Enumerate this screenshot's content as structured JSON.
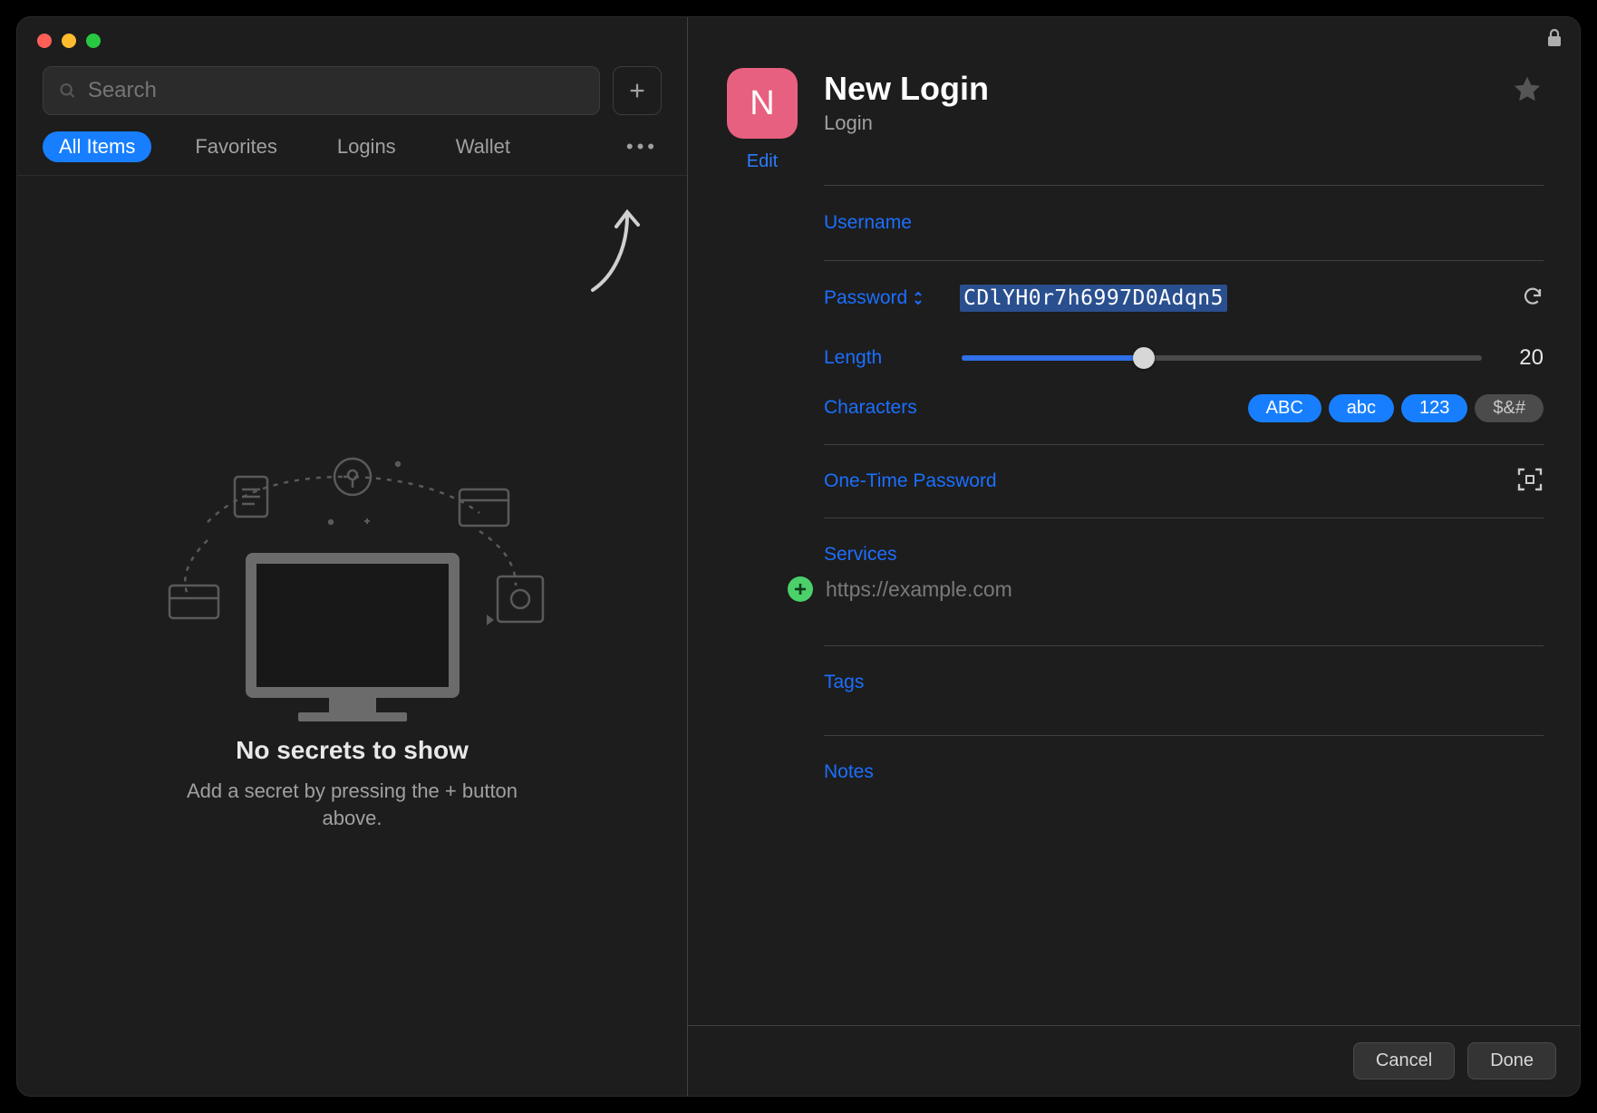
{
  "sidebar": {
    "search_placeholder": "Search",
    "tabs": [
      "All Items",
      "Favorites",
      "Logins",
      "Wallet"
    ],
    "active_tab_index": 0
  },
  "empty_state": {
    "title": "No secrets to show",
    "subtitle": "Add a secret by pressing the + button above."
  },
  "item": {
    "avatar_letter": "N",
    "title": "New Login",
    "type_label": "Login",
    "edit_label": "Edit",
    "username_label": "Username",
    "password_label": "Password",
    "password_value": "CDlYH0r7h6997D0Adqn5",
    "length_label": "Length",
    "length_value": "20",
    "length_min": 8,
    "length_max": 64,
    "length_fill_pct": 35,
    "characters_label": "Characters",
    "char_toggles": [
      {
        "label": "ABC",
        "on": true
      },
      {
        "label": "abc",
        "on": true
      },
      {
        "label": "123",
        "on": true
      },
      {
        "label": "$&#",
        "on": false
      }
    ],
    "otp_label": "One-Time Password",
    "services_label": "Services",
    "service_placeholder": "https://example.com",
    "tags_label": "Tags",
    "notes_label": "Notes"
  },
  "footer": {
    "cancel": "Cancel",
    "done": "Done"
  }
}
